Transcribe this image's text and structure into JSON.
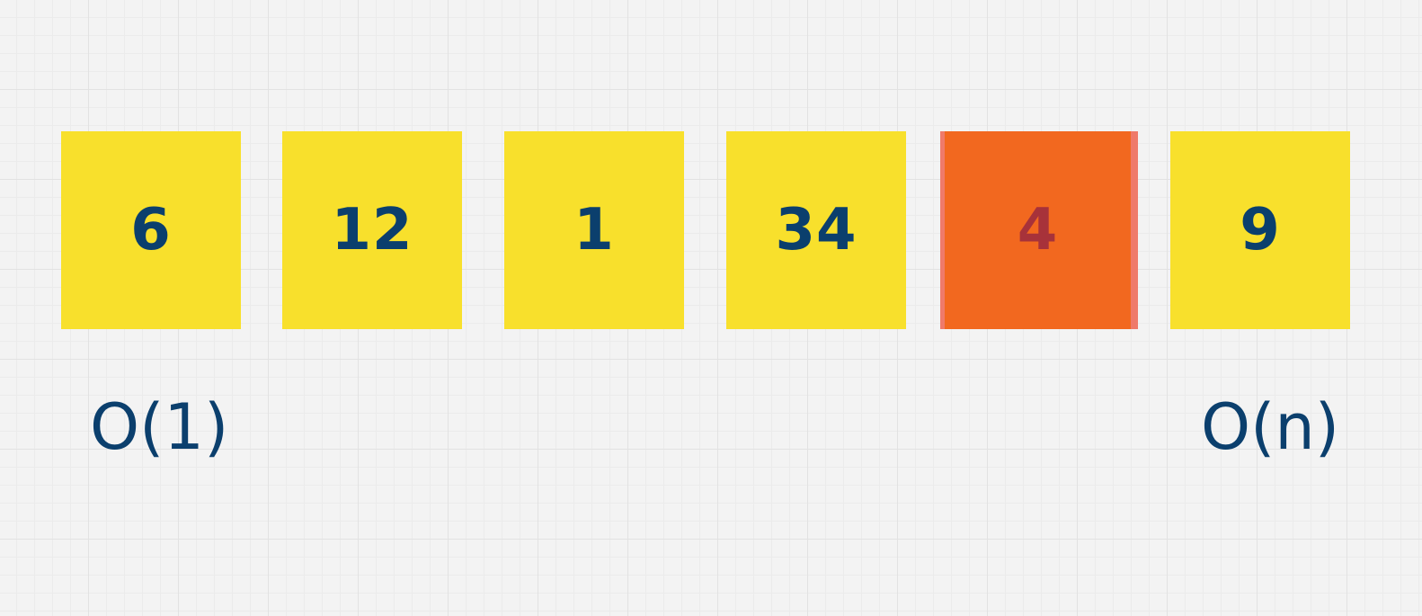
{
  "array": {
    "cells": [
      "6",
      "12",
      "1",
      "34",
      "4",
      "9"
    ],
    "highlighted_index": 4
  },
  "labels": {
    "left": "O(1)",
    "right": "O(n)"
  },
  "colors": {
    "cell_fill": "#f8e02c",
    "highlight_fill": "#f2681f",
    "highlight_edge": "#ef7a6a",
    "number_text": "#0b3f6d",
    "highlight_number_text": "#a7323a",
    "background": "#f3f3f3"
  }
}
